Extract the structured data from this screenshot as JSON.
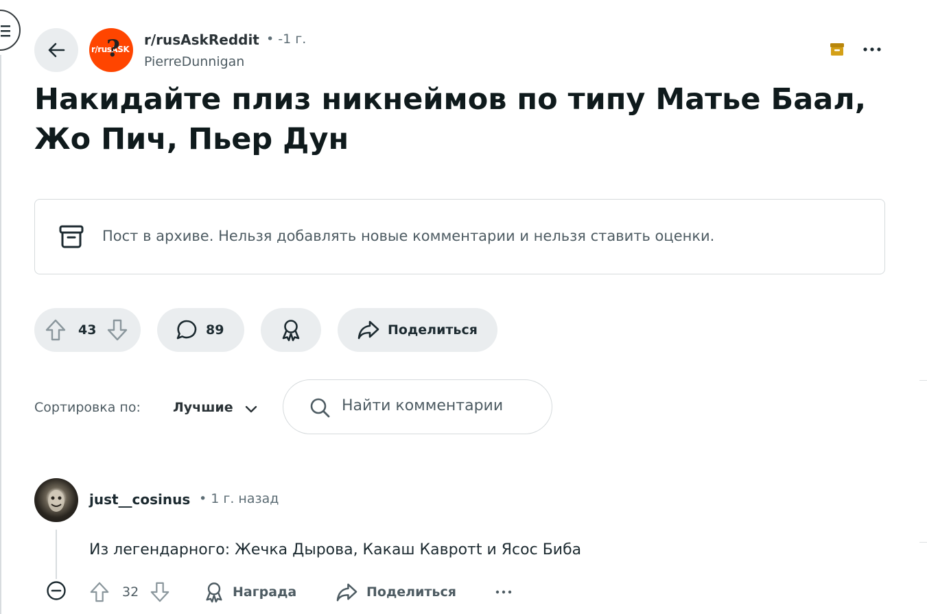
{
  "post": {
    "subreddit": "r/rusAskReddit",
    "time": "• -1 г.",
    "author": "PierreDunnigan",
    "title": "Накидайте плиз никнеймов по типу Матье Баал, Жо Пич, Пьер Дун",
    "subreddit_logo_text": "r/rusASK",
    "subreddit_logo_mark": "?"
  },
  "archive_notice": {
    "text": "Пост в архиве. Нельзя добавлять новые комментарии и нельзя ставить оценки."
  },
  "actions": {
    "votes": "43",
    "comments": "89",
    "share_label": "Поделиться"
  },
  "sort": {
    "label": "Сортировка по:",
    "value": "Лучшие"
  },
  "search": {
    "placeholder": "Найти комментарии"
  },
  "comment": {
    "username": "just__cosinus",
    "time": "• 1 г. назад",
    "text": "Из легендарного: Жечка Дырова, Какаш Кавротt и Ясос Биба",
    "votes": "32",
    "award_label": "Награда",
    "share_label": "Поделиться"
  },
  "colors": {
    "brand": "#ff4500",
    "pill_bg": "#eaedef",
    "archive_icon": "#b8860b"
  },
  "icons": [
    "menu-icon",
    "back-arrow-icon",
    "archive-icon",
    "more-icon",
    "upvote-icon",
    "downvote-icon",
    "comment-icon",
    "award-icon",
    "share-icon",
    "chevron-down-icon",
    "search-icon",
    "collapse-icon"
  ]
}
